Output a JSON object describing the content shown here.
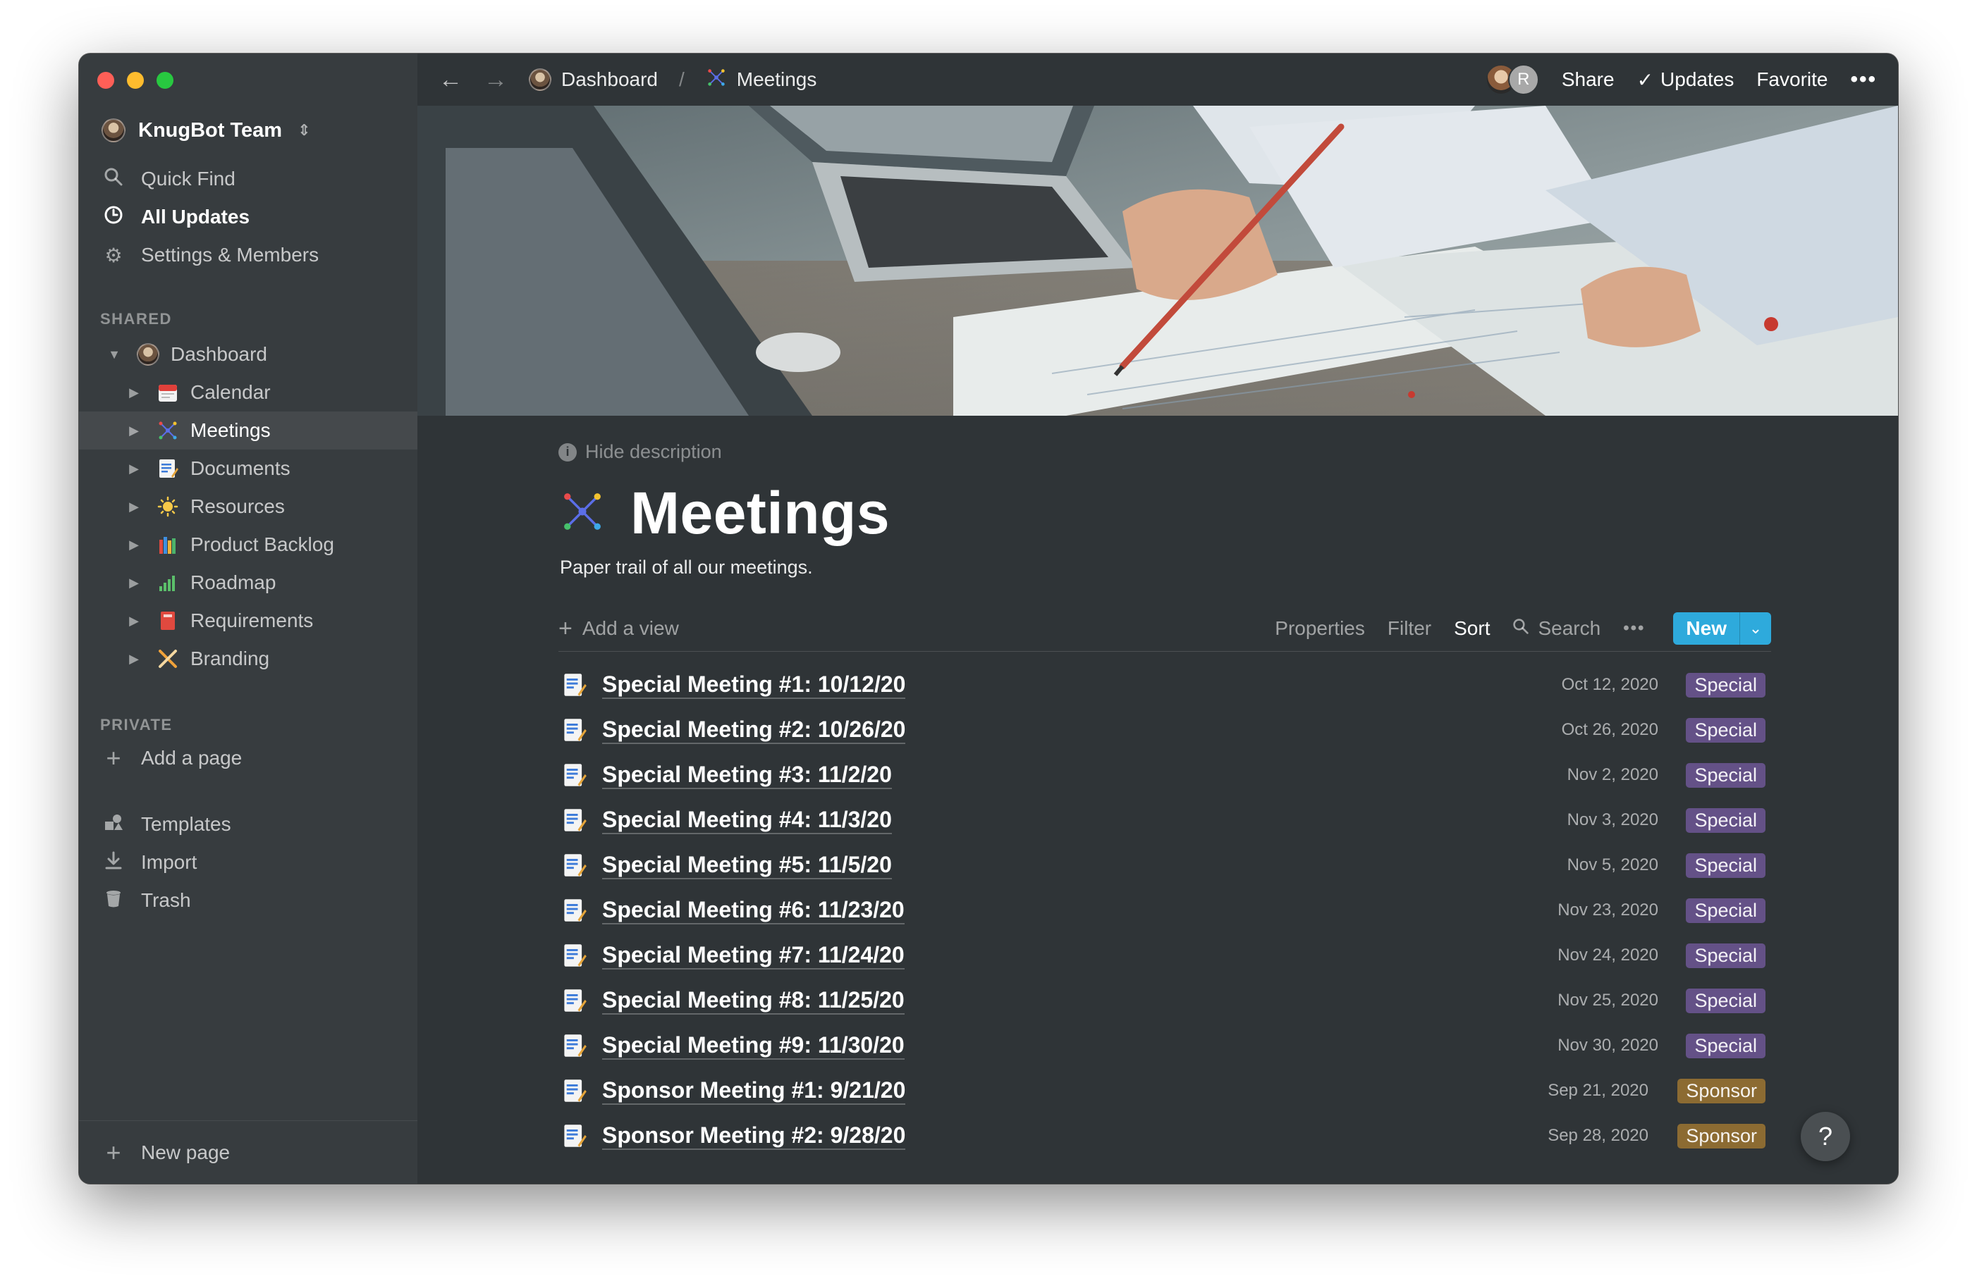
{
  "sidebar": {
    "workspace": "KnugBot Team",
    "nav": [
      {
        "label": "Quick Find",
        "icon": "search-icon"
      },
      {
        "label": "All Updates",
        "icon": "clock-icon"
      },
      {
        "label": "Settings & Members",
        "icon": "gear-icon"
      }
    ],
    "shared_label": "SHARED",
    "dashboard": "Dashboard",
    "tree": [
      {
        "label": "Calendar",
        "icon": "calendar-icon"
      },
      {
        "label": "Meetings",
        "icon": "sparkle-icon"
      },
      {
        "label": "Documents",
        "icon": "memo-icon"
      },
      {
        "label": "Resources",
        "icon": "sun-icon"
      },
      {
        "label": "Product Backlog",
        "icon": "books-icon"
      },
      {
        "label": "Roadmap",
        "icon": "bar-chart-icon"
      },
      {
        "label": "Requirements",
        "icon": "red-book-icon"
      },
      {
        "label": "Branding",
        "icon": "crossed-tools-icon"
      }
    ],
    "private_label": "PRIVATE",
    "add_page": "Add a page",
    "bottom": [
      {
        "label": "Templates",
        "icon": "shapes-icon"
      },
      {
        "label": "Import",
        "icon": "download-icon"
      },
      {
        "label": "Trash",
        "icon": "trash-icon"
      }
    ],
    "new_page": "New page"
  },
  "topbar": {
    "crumb_dashboard": "Dashboard",
    "crumb_separator": "/",
    "crumb_meetings": "Meetings",
    "avatar_initial": "R",
    "share": "Share",
    "updates": "Updates",
    "favorite": "Favorite",
    "more": "•••"
  },
  "page": {
    "hide_description": "Hide description",
    "title": "Meetings",
    "description": "Paper trail of all our meetings."
  },
  "toolbar": {
    "add_view": "Add a view",
    "properties": "Properties",
    "filter": "Filter",
    "sort": "Sort",
    "search": "Search",
    "more": "•••",
    "new": "New"
  },
  "rows": [
    {
      "title": "Special Meeting #1: 10/12/20",
      "date": "Oct 12, 2020",
      "tag": "Special"
    },
    {
      "title": "Special Meeting #2: 10/26/20",
      "date": "Oct 26, 2020",
      "tag": "Special"
    },
    {
      "title": "Special Meeting #3: 11/2/20",
      "date": "Nov 2, 2020",
      "tag": "Special"
    },
    {
      "title": "Special Meeting #4: 11/3/20",
      "date": "Nov 3, 2020",
      "tag": "Special"
    },
    {
      "title": "Special Meeting #5: 11/5/20",
      "date": "Nov 5, 2020",
      "tag": "Special"
    },
    {
      "title": "Special Meeting #6: 11/23/20",
      "date": "Nov 23, 2020",
      "tag": "Special"
    },
    {
      "title": "Special Meeting #7: 11/24/20",
      "date": "Nov 24, 2020",
      "tag": "Special"
    },
    {
      "title": "Special Meeting #8: 11/25/20",
      "date": "Nov 25, 2020",
      "tag": "Special"
    },
    {
      "title": "Special Meeting #9: 11/30/20",
      "date": "Nov 30, 2020",
      "tag": "Special"
    },
    {
      "title": "Sponsor Meeting #1: 9/21/20",
      "date": "Sep 21, 2020",
      "tag": "Sponsor"
    },
    {
      "title": "Sponsor Meeting #2: 9/28/20",
      "date": "Sep 28, 2020",
      "tag": "Sponsor"
    }
  ],
  "help": "?",
  "colors": {
    "sidebar_bg": "#373c3f",
    "main_bg": "#2f3437",
    "accent_blue": "#2eaadc",
    "tag_special": "#9a6dd7",
    "tag_sponsor": "#cb912f"
  }
}
